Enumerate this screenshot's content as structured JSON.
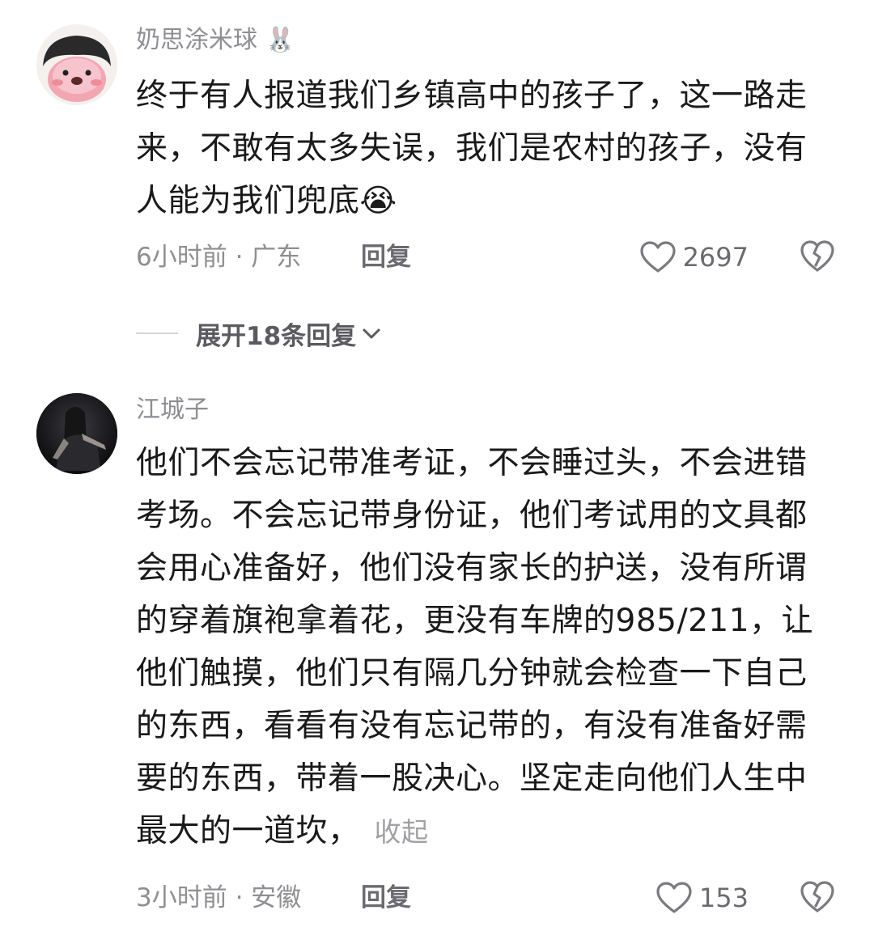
{
  "comments": [
    {
      "username": "奶思涂米球",
      "username_emoji": "🐰",
      "lines": [
        "终于有人报道我们乡镇高中的孩子了，这一路走",
        "来，不敢有太多失误，我们是农村的孩子，没有",
        "人能为我们兜底😭"
      ],
      "time": "6小时前",
      "location": "广东",
      "reply_label": "回复",
      "likes": "2697"
    },
    {
      "username": "江城子",
      "lines": [
        "他们不会忘记带准考证，不会睡过头，不会进错",
        "考场。不会忘记带身份证，他们考试用的文具都",
        "会用心准备好，他们没有家长的护送，没有所谓",
        "的穿着旗袍拿着花，更没有车牌的985/211，让",
        "他们触摸，他们只有隔几分钟就会检查一下自己",
        "的东西，看看有没有忘记带的，有没有准备好需",
        "要的东西，带着一股决心。坚定走向他们人生中",
        "最大的一道坎，"
      ],
      "collapse_label": "收起",
      "time": "3小时前",
      "location": "安徽",
      "reply_label": "回复",
      "likes": "153"
    }
  ],
  "expand_replies": "展开18条回复",
  "meta_separator": " · ",
  "icons": {
    "like": "heart-outline-icon",
    "dislike": "broken-heart-icon",
    "expand": "chevron-down-icon"
  }
}
